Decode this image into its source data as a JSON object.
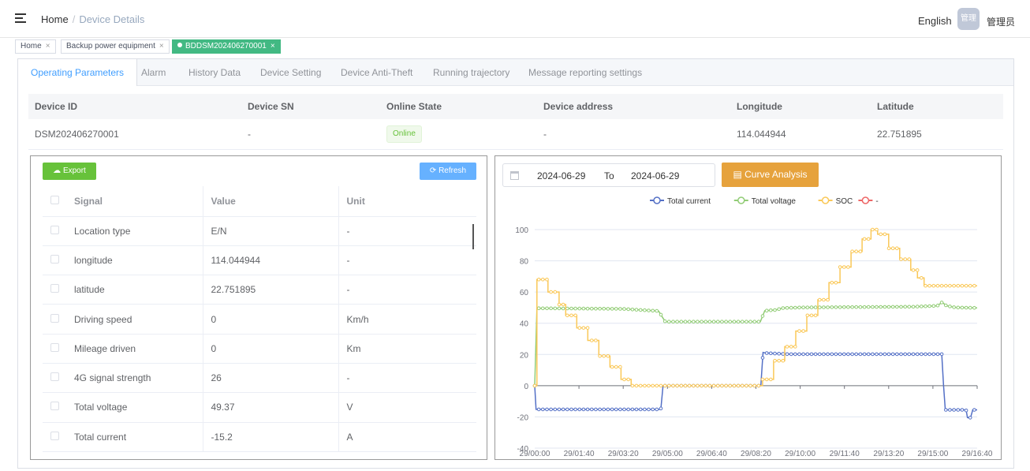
{
  "header": {
    "menu_icon": "hamburger-icon",
    "breadcrumb_home": "Home",
    "breadcrumb_sep": "/",
    "breadcrumb_current": "Device Details",
    "language": "English",
    "avatar_text": "管理",
    "username": "管理员"
  },
  "tags": [
    {
      "label": "Home",
      "close": "×",
      "active": false
    },
    {
      "label": "Backup power equipment",
      "close": "×",
      "active": false
    },
    {
      "label": "BDDSM202406270001",
      "close": "×",
      "active": true
    }
  ],
  "tabs": [
    {
      "label": "Operating Parameters",
      "active": true
    },
    {
      "label": "Alarm"
    },
    {
      "label": "History Data"
    },
    {
      "label": "Device Setting"
    },
    {
      "label": "Device Anti-Theft"
    },
    {
      "label": "Running trajectory"
    },
    {
      "label": "Message reporting settings"
    }
  ],
  "device": {
    "headers": [
      "Device ID",
      "Device SN",
      "Online State",
      "Device address",
      "Longitude",
      "Latitude"
    ],
    "row": {
      "id": "DSM202406270001",
      "sn": "-",
      "state": "Online",
      "address": "-",
      "longitude": "114.044944",
      "latitude": "22.751895"
    }
  },
  "signals": {
    "export_label": "Export",
    "refresh_label": "Refresh",
    "headers": [
      "Signal",
      "Value",
      "Unit"
    ],
    "rows": [
      {
        "signal": "Location type",
        "value": "E/N",
        "unit": "-"
      },
      {
        "signal": "longitude",
        "value": "114.044944",
        "unit": "-"
      },
      {
        "signal": "latitude",
        "value": "22.751895",
        "unit": "-"
      },
      {
        "signal": "Driving speed",
        "value": "0",
        "unit": "Km/h"
      },
      {
        "signal": "Mileage driven",
        "value": "0",
        "unit": "Km"
      },
      {
        "signal": "4G signal strength",
        "value": "26",
        "unit": "-"
      },
      {
        "signal": "Total voltage",
        "value": "49.37",
        "unit": "V"
      },
      {
        "signal": "Total current",
        "value": "-15.2",
        "unit": "A"
      }
    ]
  },
  "curve": {
    "date_from": "2024-06-29",
    "to_label": "To",
    "date_to": "2024-06-29",
    "analysis_label": "Curve Analysis"
  },
  "chart_data": {
    "type": "line",
    "legend_position": "top",
    "legend": [
      "Total current",
      "Total voltage",
      "SOC",
      "-"
    ],
    "colors": {
      "Total current": "#5470c6",
      "Total voltage": "#91cc75",
      "SOC": "#fac858",
      "-": "#ee6666"
    },
    "ylim": [
      -40,
      100
    ],
    "yticks": [
      100,
      80,
      60,
      40,
      20,
      0,
      -20,
      -40
    ],
    "xticks": [
      "29/00:00",
      "29/01:40",
      "29/03:20",
      "29/05:00",
      "29/06:40",
      "29/08:20",
      "29/10:00",
      "29/11:40",
      "29/13:20",
      "29/15:00",
      "29/16:40"
    ],
    "x_range_minutes": [
      0,
      1000
    ],
    "grid": true,
    "series": [
      {
        "name": "Total current",
        "segments": [
          [
            0,
            0
          ],
          [
            3,
            -15.2
          ],
          [
            285,
            -15.2
          ],
          [
            290,
            0
          ],
          [
            511,
            0
          ],
          [
            516,
            21.3
          ],
          [
            520,
            21
          ],
          [
            550,
            20.5
          ],
          [
            575,
            20.2
          ],
          [
            920,
            20.2
          ],
          [
            924,
            0
          ],
          [
            928,
            -15.5
          ],
          [
            960,
            -15.5
          ],
          [
            965,
            -15.5
          ],
          [
            975,
            -15.5
          ],
          [
            978,
            -20.5
          ],
          [
            985,
            -20.5
          ],
          [
            990,
            -15.5
          ],
          [
            1000,
            -15.5
          ]
        ]
      },
      {
        "name": "Total voltage",
        "segments": [
          [
            0,
            0
          ],
          [
            5,
            49.6
          ],
          [
            200,
            49.2
          ],
          [
            250,
            48.3
          ],
          [
            280,
            47.8
          ],
          [
            295,
            41
          ],
          [
            510,
            41
          ],
          [
            520,
            48
          ],
          [
            545,
            48.5
          ],
          [
            560,
            49.7
          ],
          [
            600,
            50.1
          ],
          [
            700,
            50.3
          ],
          [
            860,
            50.6
          ],
          [
            910,
            51.2
          ],
          [
            921,
            53.5
          ],
          [
            930,
            51.3
          ],
          [
            950,
            50.1
          ],
          [
            1000,
            49.8
          ]
        ]
      },
      {
        "name": "SOC",
        "steps": [
          [
            0,
            0
          ],
          [
            5,
            68
          ],
          [
            30,
            60
          ],
          [
            55,
            52
          ],
          [
            70,
            45
          ],
          [
            95,
            37
          ],
          [
            120,
            29
          ],
          [
            145,
            19
          ],
          [
            170,
            12
          ],
          [
            195,
            4
          ],
          [
            218,
            0
          ],
          [
            510,
            0
          ],
          [
            515,
            4
          ],
          [
            540,
            16
          ],
          [
            565,
            25
          ],
          [
            590,
            35
          ],
          [
            615,
            45
          ],
          [
            640,
            55
          ],
          [
            665,
            66
          ],
          [
            690,
            76
          ],
          [
            715,
            86
          ],
          [
            740,
            94
          ],
          [
            760,
            100
          ],
          [
            775,
            97
          ],
          [
            800,
            88
          ],
          [
            825,
            81
          ],
          [
            850,
            74
          ],
          [
            865,
            69
          ],
          [
            880,
            64
          ],
          [
            1000,
            64
          ]
        ]
      },
      {
        "name": "-",
        "values": []
      }
    ]
  }
}
